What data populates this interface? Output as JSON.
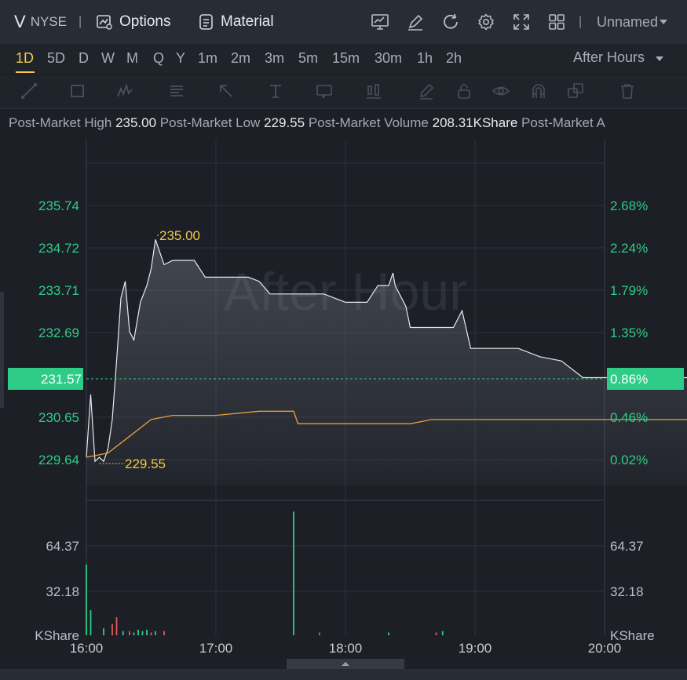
{
  "header": {
    "ticker": "V",
    "exchange": "NYSE",
    "separator": "|",
    "options_label": "Options",
    "material_label": "Material",
    "layout_name": "Unnamed"
  },
  "periods": [
    "1D",
    "5D",
    "D",
    "W",
    "M",
    "Q",
    "Y",
    "1m",
    "2m",
    "3m",
    "5m",
    "15m",
    "30m",
    "1h",
    "2h"
  ],
  "active_period": "1D",
  "session_select": "After Hours",
  "stats": [
    {
      "label": "Post-Market High",
      "value": "235.00"
    },
    {
      "label": "Post-Market Low",
      "value": "229.55"
    },
    {
      "label": "Post-Market Volume",
      "value": "208.31KShare"
    },
    {
      "label": "Post-Market A",
      "value": ""
    }
  ],
  "watermark": "After Hour",
  "colors": {
    "up": "#2ecc87",
    "down": "#e05c5c",
    "highlight": "#f2c94c",
    "line": "#e8eaee",
    "avg": "#e8a03a"
  },
  "chart_data": {
    "type": "line",
    "x_ticks": [
      "16:00",
      "17:00",
      "18:00",
      "19:00",
      "20:00"
    ],
    "price_ticks": [
      "235.74",
      "234.72",
      "233.71",
      "232.69",
      "231.57",
      "230.65",
      "229.64"
    ],
    "pct_ticks": [
      "2.68%",
      "2.24%",
      "1.79%",
      "1.35%",
      "0.86%",
      "0.46%",
      "0.02%"
    ],
    "current_price": "231.57",
    "current_pct": "0.86%",
    "high_label": "235.00",
    "low_label": "229.55",
    "volume_ticks": [
      "64.37",
      "32.18"
    ],
    "volume_unit": "KShare",
    "price_series": [
      [
        0,
        229.7
      ],
      [
        2,
        231.2
      ],
      [
        4,
        229.6
      ],
      [
        6,
        229.7
      ],
      [
        8,
        229.6
      ],
      [
        10,
        229.9
      ],
      [
        12,
        230.6
      ],
      [
        14,
        232.0
      ],
      [
        16,
        233.5
      ],
      [
        18,
        233.9
      ],
      [
        20,
        232.7
      ],
      [
        22,
        232.5
      ],
      [
        25,
        233.4
      ],
      [
        28,
        233.8
      ],
      [
        30,
        234.2
      ],
      [
        32,
        234.9
      ],
      [
        34,
        234.6
      ],
      [
        36,
        234.3
      ],
      [
        40,
        234.4
      ],
      [
        50,
        234.4
      ],
      [
        55,
        234.0
      ],
      [
        65,
        234.0
      ],
      [
        75,
        234.0
      ],
      [
        80,
        233.9
      ],
      [
        85,
        233.6
      ],
      [
        100,
        233.6
      ],
      [
        110,
        233.6
      ],
      [
        120,
        233.4
      ],
      [
        130,
        233.4
      ],
      [
        135,
        233.8
      ],
      [
        140,
        233.8
      ],
      [
        142,
        234.1
      ],
      [
        143,
        233.8
      ],
      [
        148,
        233.3
      ],
      [
        150,
        232.8
      ],
      [
        170,
        232.8
      ],
      [
        174,
        233.2
      ],
      [
        178,
        232.3
      ],
      [
        190,
        232.3
      ],
      [
        200,
        232.3
      ],
      [
        210,
        232.1
      ],
      [
        220,
        232.0
      ],
      [
        230,
        231.6
      ],
      [
        240,
        231.6
      ],
      [
        260,
        231.6
      ],
      [
        280,
        231.6
      ],
      [
        300,
        231.6
      ],
      [
        320,
        231.6
      ],
      [
        331,
        231.6
      ]
    ],
    "avg_series": [
      [
        0,
        229.7
      ],
      [
        10,
        229.8
      ],
      [
        20,
        230.2
      ],
      [
        30,
        230.6
      ],
      [
        40,
        230.7
      ],
      [
        60,
        230.7
      ],
      [
        80,
        230.8
      ],
      [
        96,
        230.8
      ],
      [
        98,
        230.5
      ],
      [
        120,
        230.5
      ],
      [
        150,
        230.5
      ],
      [
        160,
        230.6
      ],
      [
        200,
        230.6
      ],
      [
        250,
        230.6
      ],
      [
        300,
        230.6
      ],
      [
        331,
        230.6
      ]
    ],
    "volume_series": [
      [
        0,
        51,
        "up"
      ],
      [
        2,
        18,
        "up"
      ],
      [
        8,
        5,
        "up"
      ],
      [
        12,
        8,
        "down"
      ],
      [
        14,
        13,
        "down"
      ],
      [
        17,
        3,
        "up"
      ],
      [
        20,
        3,
        "down"
      ],
      [
        22,
        2,
        "up"
      ],
      [
        24,
        4,
        "up"
      ],
      [
        26,
        3,
        "up"
      ],
      [
        28,
        4,
        "up"
      ],
      [
        30,
        2,
        "down"
      ],
      [
        32,
        3,
        "up"
      ],
      [
        36,
        3,
        "down"
      ],
      [
        96,
        89,
        "up"
      ],
      [
        108,
        2,
        "down"
      ],
      [
        140,
        2,
        "up"
      ],
      [
        162,
        2,
        "down"
      ],
      [
        165,
        3,
        "up"
      ]
    ]
  }
}
